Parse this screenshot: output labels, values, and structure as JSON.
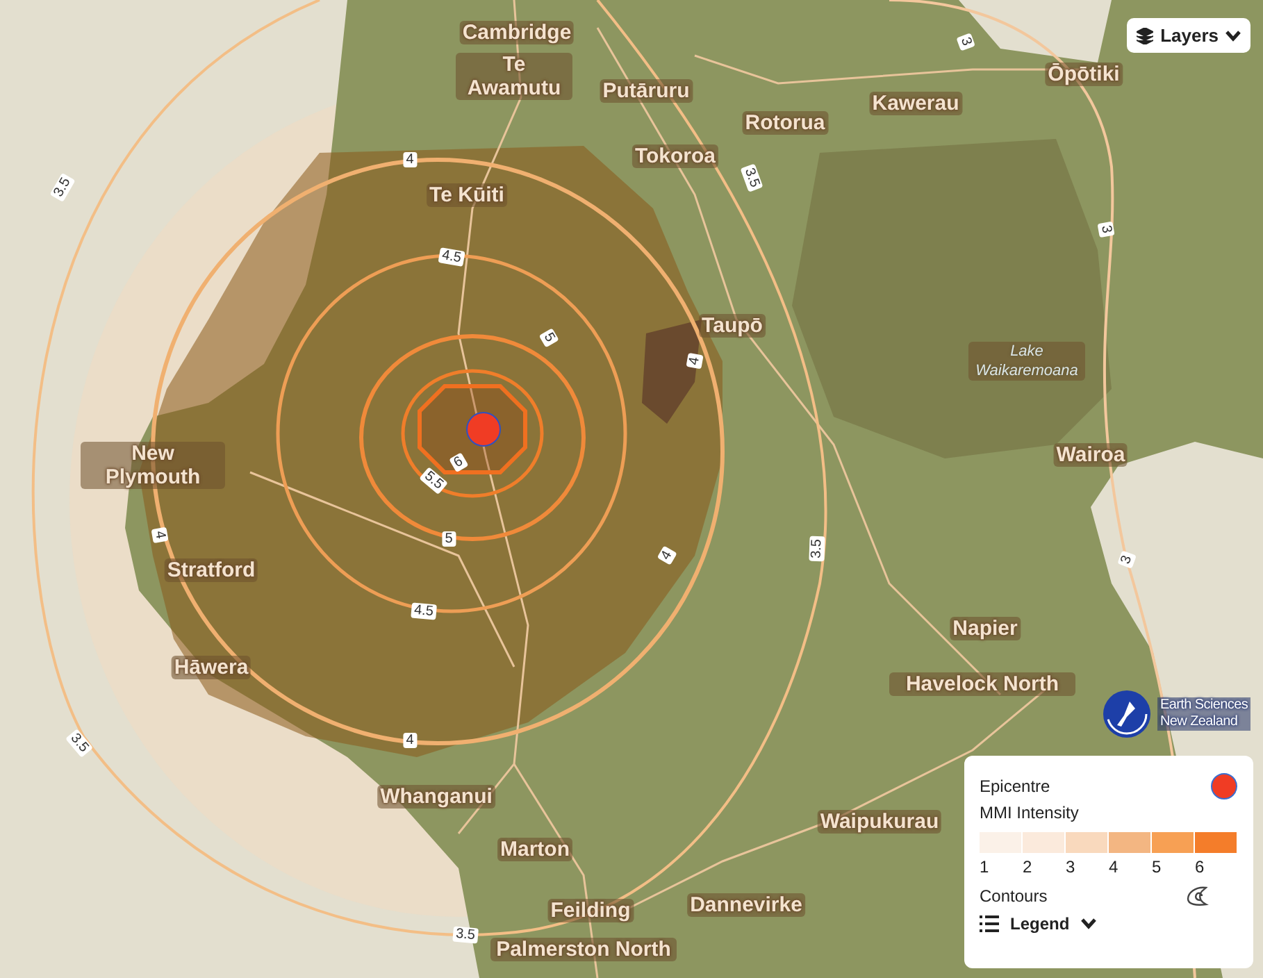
{
  "map": {
    "places": [
      {
        "name": "Cambridge",
        "kind": "town"
      },
      {
        "name": "Te Awamutu",
        "kind": "town"
      },
      {
        "name": "Putāruru",
        "kind": "town"
      },
      {
        "name": "Rotorua",
        "kind": "town"
      },
      {
        "name": "Kawerau",
        "kind": "town"
      },
      {
        "name": "Ōpōtiki",
        "kind": "town"
      },
      {
        "name": "Tokoroa",
        "kind": "town"
      },
      {
        "name": "Te Kūiti",
        "kind": "town"
      },
      {
        "name": "Taupō",
        "kind": "town"
      },
      {
        "name": "Lake Waikaremoana",
        "kind": "water"
      },
      {
        "name": "Wairoa",
        "kind": "town"
      },
      {
        "name": "New Plymouth",
        "kind": "town"
      },
      {
        "name": "Stratford",
        "kind": "town"
      },
      {
        "name": "Hāwera",
        "kind": "town"
      },
      {
        "name": "Napier",
        "kind": "town"
      },
      {
        "name": "Havelock North",
        "kind": "town"
      },
      {
        "name": "Whanganui",
        "kind": "town"
      },
      {
        "name": "Marton",
        "kind": "town"
      },
      {
        "name": "Waipukurau",
        "kind": "town"
      },
      {
        "name": "Feilding",
        "kind": "town"
      },
      {
        "name": "Dannevirke",
        "kind": "town"
      },
      {
        "name": "Palmerston North",
        "kind": "town"
      }
    ],
    "contour_labels": [
      "3.5",
      "3.5",
      "3.5",
      "3.5",
      "3.5",
      "3",
      "3",
      "3",
      "4",
      "4",
      "4",
      "4",
      "4",
      "4.5",
      "4.5",
      "5",
      "5",
      "5.5",
      "6"
    ]
  },
  "layers_button": {
    "label": "Layers"
  },
  "logo": {
    "line_1": "Earth Sciences",
    "line_2": "New Zealand"
  },
  "legend": {
    "epicentre": "Epicentre",
    "intensity_title": "MMI Intensity",
    "scale": [
      {
        "label": "1",
        "color": "#fbf1e8"
      },
      {
        "label": "2",
        "color": "#fbeadc"
      },
      {
        "label": "3",
        "color": "#f9d9bd"
      },
      {
        "label": "4",
        "color": "#f3b682"
      },
      {
        "label": "5",
        "color": "#f7a054"
      },
      {
        "label": "6",
        "color": "#f47d2a"
      }
    ],
    "contours": "Contours",
    "toggle": "Legend"
  }
}
